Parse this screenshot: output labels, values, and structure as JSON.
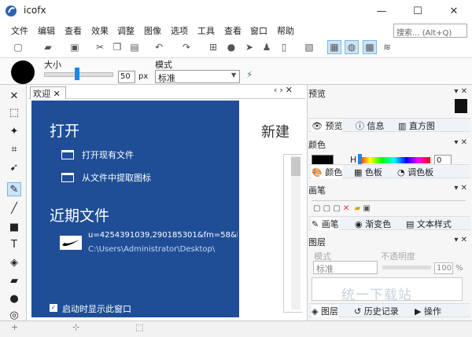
{
  "window": {
    "title": "icofx",
    "minimize": "—",
    "maximize": "☐",
    "close": "✕"
  },
  "menus": [
    "文件",
    "编辑",
    "查看",
    "效果",
    "调整",
    "图像",
    "选项",
    "工具",
    "查看",
    "窗口",
    "帮助"
  ],
  "search": {
    "placeholder": "搜索... (Alt+Q)"
  },
  "options": {
    "size_label": "大小",
    "size_value": "50",
    "size_unit": "px",
    "mode_label": "模式",
    "mode_value": "标准"
  },
  "tabs": {
    "welcome": "欢迎",
    "close": "✕"
  },
  "welcome": {
    "open_title": "打开",
    "open_existing": "打开现有文件",
    "extract_icon": "从文件中提取图标",
    "recent_title": "近期文件",
    "recent_file": "u=4254391039,290185301&fm=58&b",
    "recent_path": "C:\\Users\\Administrator\\Desktop\\",
    "startup_checkbox": "启动时显示此窗口",
    "new_title": "新建"
  },
  "panels": {
    "preview": {
      "title": "预览",
      "tabs": [
        "预览",
        "信息",
        "直方图"
      ]
    },
    "color": {
      "title": "颜色",
      "h_label": "H",
      "h_value": "0",
      "tabs": [
        "颜色",
        "色板",
        "调色板"
      ]
    },
    "brush": {
      "title": "画笔",
      "tabs": [
        "画笔",
        "渐变色",
        "文本样式"
      ]
    },
    "layers": {
      "title": "图层",
      "mode_label": "模式",
      "opacity_label": "不透明度",
      "mode_value": "标准",
      "opacity_value": "100",
      "opacity_unit": "%",
      "tabs": [
        "图层",
        "历史记录",
        "操作"
      ]
    }
  },
  "watermark": "统一下载站",
  "accent_color": "#1f4e97"
}
